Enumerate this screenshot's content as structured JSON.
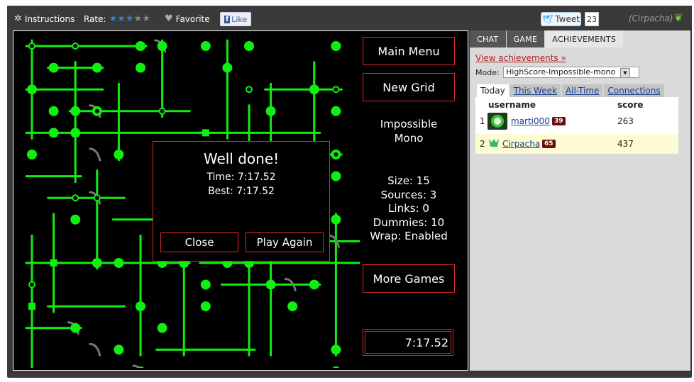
{
  "topbar": {
    "instructions": "Instructions",
    "rate_label": "Rate:",
    "rating": 3,
    "rating_max": 5,
    "favorite": "Favorite",
    "like": "Like",
    "tweet": "Tweet",
    "tweet_count": "23",
    "user": "(Cirpacha)"
  },
  "game": {
    "buttons": {
      "main_menu": "Main Menu",
      "new_grid": "New Grid",
      "more_games": "More Games"
    },
    "difficulty_line1": "Impossible",
    "difficulty_line2": "Mono",
    "stats": {
      "size": "Size: 15",
      "sources": "Sources: 3",
      "links": "Links: 0",
      "dummies": "Dummies: 10",
      "wrap": "Wrap: Enabled"
    },
    "timer": "7:17.52",
    "dialog": {
      "title": "Well done!",
      "time": "Time: 7:17.52",
      "best": "Best: 7:17.52",
      "close": "Close",
      "play_again": "Play Again"
    },
    "colors": {
      "pipe": "#11ee11",
      "dummy": "#777777",
      "border": "#d92b2b"
    }
  },
  "sidebar": {
    "tabs": [
      "CHAT",
      "GAME",
      "ACHIEVEMENTS"
    ],
    "active_tab": "ACHIEVEMENTS",
    "view_achievements": "View achievements »",
    "mode_label": "Mode:",
    "mode_value": "HighScore-Impossible-mono",
    "subtabs": [
      "Today",
      "This Week",
      "All-Time",
      "Connections"
    ],
    "columns": {
      "username": "username",
      "score": "score"
    },
    "rows": [
      {
        "rank": "1",
        "name": "marti000",
        "level": "39",
        "score": "263"
      },
      {
        "rank": "2",
        "name": "Cirpacha",
        "level": "65",
        "score": "437"
      }
    ]
  }
}
